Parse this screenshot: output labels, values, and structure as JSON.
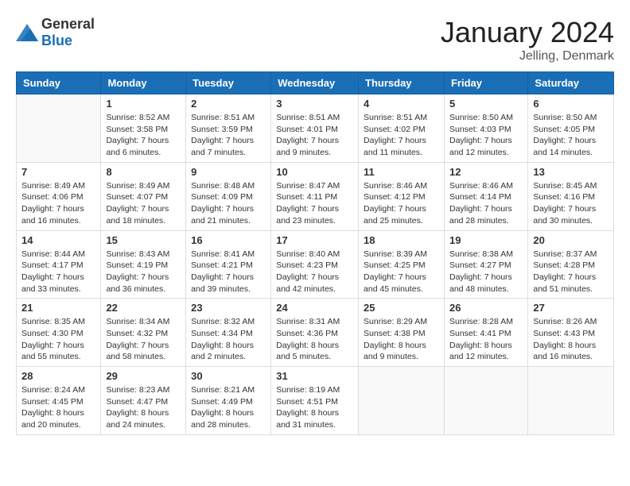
{
  "header": {
    "logo": {
      "general": "General",
      "blue": "Blue"
    },
    "title": "January 2024",
    "location": "Jelling, Denmark"
  },
  "calendar": {
    "days_of_week": [
      "Sunday",
      "Monday",
      "Tuesday",
      "Wednesday",
      "Thursday",
      "Friday",
      "Saturday"
    ],
    "weeks": [
      [
        {
          "day": "",
          "sunrise": "",
          "sunset": "",
          "daylight": ""
        },
        {
          "day": "1",
          "sunrise": "Sunrise: 8:52 AM",
          "sunset": "Sunset: 3:58 PM",
          "daylight": "Daylight: 7 hours and 6 minutes."
        },
        {
          "day": "2",
          "sunrise": "Sunrise: 8:51 AM",
          "sunset": "Sunset: 3:59 PM",
          "daylight": "Daylight: 7 hours and 7 minutes."
        },
        {
          "day": "3",
          "sunrise": "Sunrise: 8:51 AM",
          "sunset": "Sunset: 4:01 PM",
          "daylight": "Daylight: 7 hours and 9 minutes."
        },
        {
          "day": "4",
          "sunrise": "Sunrise: 8:51 AM",
          "sunset": "Sunset: 4:02 PM",
          "daylight": "Daylight: 7 hours and 11 minutes."
        },
        {
          "day": "5",
          "sunrise": "Sunrise: 8:50 AM",
          "sunset": "Sunset: 4:03 PM",
          "daylight": "Daylight: 7 hours and 12 minutes."
        },
        {
          "day": "6",
          "sunrise": "Sunrise: 8:50 AM",
          "sunset": "Sunset: 4:05 PM",
          "daylight": "Daylight: 7 hours and 14 minutes."
        }
      ],
      [
        {
          "day": "7",
          "sunrise": "Sunrise: 8:49 AM",
          "sunset": "Sunset: 4:06 PM",
          "daylight": "Daylight: 7 hours and 16 minutes."
        },
        {
          "day": "8",
          "sunrise": "Sunrise: 8:49 AM",
          "sunset": "Sunset: 4:07 PM",
          "daylight": "Daylight: 7 hours and 18 minutes."
        },
        {
          "day": "9",
          "sunrise": "Sunrise: 8:48 AM",
          "sunset": "Sunset: 4:09 PM",
          "daylight": "Daylight: 7 hours and 21 minutes."
        },
        {
          "day": "10",
          "sunrise": "Sunrise: 8:47 AM",
          "sunset": "Sunset: 4:11 PM",
          "daylight": "Daylight: 7 hours and 23 minutes."
        },
        {
          "day": "11",
          "sunrise": "Sunrise: 8:46 AM",
          "sunset": "Sunset: 4:12 PM",
          "daylight": "Daylight: 7 hours and 25 minutes."
        },
        {
          "day": "12",
          "sunrise": "Sunrise: 8:46 AM",
          "sunset": "Sunset: 4:14 PM",
          "daylight": "Daylight: 7 hours and 28 minutes."
        },
        {
          "day": "13",
          "sunrise": "Sunrise: 8:45 AM",
          "sunset": "Sunset: 4:16 PM",
          "daylight": "Daylight: 7 hours and 30 minutes."
        }
      ],
      [
        {
          "day": "14",
          "sunrise": "Sunrise: 8:44 AM",
          "sunset": "Sunset: 4:17 PM",
          "daylight": "Daylight: 7 hours and 33 minutes."
        },
        {
          "day": "15",
          "sunrise": "Sunrise: 8:43 AM",
          "sunset": "Sunset: 4:19 PM",
          "daylight": "Daylight: 7 hours and 36 minutes."
        },
        {
          "day": "16",
          "sunrise": "Sunrise: 8:41 AM",
          "sunset": "Sunset: 4:21 PM",
          "daylight": "Daylight: 7 hours and 39 minutes."
        },
        {
          "day": "17",
          "sunrise": "Sunrise: 8:40 AM",
          "sunset": "Sunset: 4:23 PM",
          "daylight": "Daylight: 7 hours and 42 minutes."
        },
        {
          "day": "18",
          "sunrise": "Sunrise: 8:39 AM",
          "sunset": "Sunset: 4:25 PM",
          "daylight": "Daylight: 7 hours and 45 minutes."
        },
        {
          "day": "19",
          "sunrise": "Sunrise: 8:38 AM",
          "sunset": "Sunset: 4:27 PM",
          "daylight": "Daylight: 7 hours and 48 minutes."
        },
        {
          "day": "20",
          "sunrise": "Sunrise: 8:37 AM",
          "sunset": "Sunset: 4:28 PM",
          "daylight": "Daylight: 7 hours and 51 minutes."
        }
      ],
      [
        {
          "day": "21",
          "sunrise": "Sunrise: 8:35 AM",
          "sunset": "Sunset: 4:30 PM",
          "daylight": "Daylight: 7 hours and 55 minutes."
        },
        {
          "day": "22",
          "sunrise": "Sunrise: 8:34 AM",
          "sunset": "Sunset: 4:32 PM",
          "daylight": "Daylight: 7 hours and 58 minutes."
        },
        {
          "day": "23",
          "sunrise": "Sunrise: 8:32 AM",
          "sunset": "Sunset: 4:34 PM",
          "daylight": "Daylight: 8 hours and 2 minutes."
        },
        {
          "day": "24",
          "sunrise": "Sunrise: 8:31 AM",
          "sunset": "Sunset: 4:36 PM",
          "daylight": "Daylight: 8 hours and 5 minutes."
        },
        {
          "day": "25",
          "sunrise": "Sunrise: 8:29 AM",
          "sunset": "Sunset: 4:38 PM",
          "daylight": "Daylight: 8 hours and 9 minutes."
        },
        {
          "day": "26",
          "sunrise": "Sunrise: 8:28 AM",
          "sunset": "Sunset: 4:41 PM",
          "daylight": "Daylight: 8 hours and 12 minutes."
        },
        {
          "day": "27",
          "sunrise": "Sunrise: 8:26 AM",
          "sunset": "Sunset: 4:43 PM",
          "daylight": "Daylight: 8 hours and 16 minutes."
        }
      ],
      [
        {
          "day": "28",
          "sunrise": "Sunrise: 8:24 AM",
          "sunset": "Sunset: 4:45 PM",
          "daylight": "Daylight: 8 hours and 20 minutes."
        },
        {
          "day": "29",
          "sunrise": "Sunrise: 8:23 AM",
          "sunset": "Sunset: 4:47 PM",
          "daylight": "Daylight: 8 hours and 24 minutes."
        },
        {
          "day": "30",
          "sunrise": "Sunrise: 8:21 AM",
          "sunset": "Sunset: 4:49 PM",
          "daylight": "Daylight: 8 hours and 28 minutes."
        },
        {
          "day": "31",
          "sunrise": "Sunrise: 8:19 AM",
          "sunset": "Sunset: 4:51 PM",
          "daylight": "Daylight: 8 hours and 31 minutes."
        },
        {
          "day": "",
          "sunrise": "",
          "sunset": "",
          "daylight": ""
        },
        {
          "day": "",
          "sunrise": "",
          "sunset": "",
          "daylight": ""
        },
        {
          "day": "",
          "sunrise": "",
          "sunset": "",
          "daylight": ""
        }
      ]
    ]
  }
}
